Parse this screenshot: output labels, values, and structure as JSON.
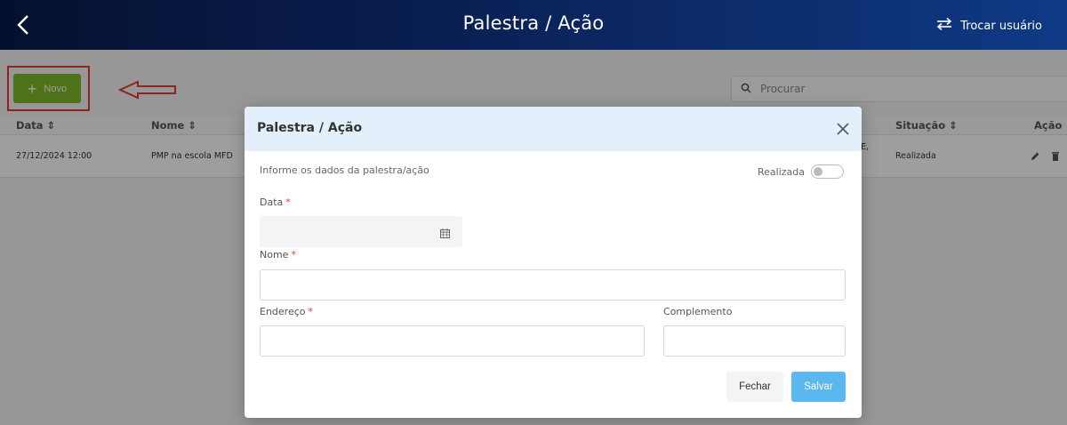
{
  "header": {
    "title": "Palestra / Ação",
    "switch_user_label": "Trocar usuário"
  },
  "toolbar": {
    "new_label": "Novo",
    "search_placeholder": "Procurar"
  },
  "table": {
    "columns": [
      "Data",
      "Nome",
      "Situação",
      "Ação"
    ],
    "rows": [
      {
        "data": "27/12/2024 12:00",
        "nome": "PMP na escola MFD",
        "partial": "E,",
        "situacao": "Realizada"
      }
    ]
  },
  "modal": {
    "title": "Palestra / Ação",
    "info": "Informe os dados da palestra/ação",
    "realizada_label": "Realizada",
    "realizada_on": false,
    "fields": {
      "data_label": "Data",
      "nome_label": "Nome",
      "endereco_label": "Endereço",
      "complemento_label": "Complemento",
      "required_mark": "*"
    },
    "buttons": {
      "close": "Fechar",
      "save": "Salvar"
    }
  },
  "colors": {
    "accent_green": "#7fb82a",
    "save_blue": "#5bb8ee",
    "annotation_red": "#e53935",
    "modal_header": "#e3f0fb"
  }
}
